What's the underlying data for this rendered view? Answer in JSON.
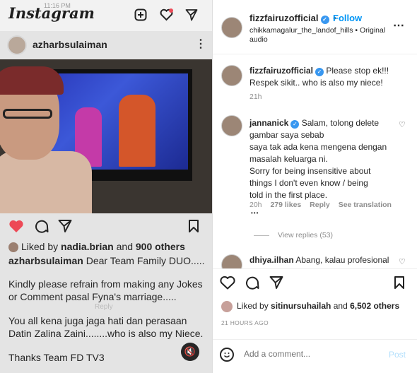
{
  "left": {
    "app_logo": "Instagram",
    "status_time": "11:16 PM",
    "story_username": "azharbsulaiman",
    "liked_by_prefix": "Liked by ",
    "liked_by_user": "nadia.brian",
    "liked_by_and": " and ",
    "liked_by_count": "900 others",
    "caption_user": "azharbsulaiman",
    "caption_first": " Dear Team Family DUO.....",
    "caption_lines": [
      "Kindly please refrain from making any Jokes",
      "or Comment pasal Fyna's marriage.....",
      "You all kena juga jaga hati dan perasaan",
      "Datin Zalina Zaini........who is also my Niece.",
      "Thanks Team FD TV3"
    ],
    "reply_ghost": "Reply"
  },
  "right": {
    "header": {
      "username": "fizzfairuzofficial",
      "follow_label": "Follow",
      "separator": "•",
      "location": "chikkamagalur_the_landof_hills • Original audio"
    },
    "comments": [
      {
        "username": "fizzfairuzofficial",
        "text": "Please stop ek!!! Respek sikit.. who is also my niece!",
        "time": "21h"
      },
      {
        "username": "jannanick",
        "text_lines": [
          "Salam, tolong delete",
          "gambar saya sebab",
          "saya tak ada kena mengena dengan",
          "masalah keluarga ni.",
          "Sorry for being insensitive about",
          "things I don't even know / being",
          "told in the first place."
        ],
        "time": "20h",
        "likes": "279 likes",
        "reply_label": "Reply",
        "translation_label": "See translation",
        "more": "•••",
        "view_replies": "View replies (53)"
      },
      {
        "username": "dhiya.ilhan",
        "text": "Abang, kalau profesional"
      }
    ],
    "likes_prefix": "Liked by ",
    "likes_user": "sitinursuhailah",
    "likes_and": " and ",
    "likes_count": "6,502 others",
    "date": "21 HOURS AGO",
    "add_comment_placeholder": "Add a comment...",
    "post_label": "Post"
  },
  "colors": {
    "link_blue": "#0095f6",
    "heart_red": "#ed4956",
    "verified_blue": "#3897f0"
  }
}
